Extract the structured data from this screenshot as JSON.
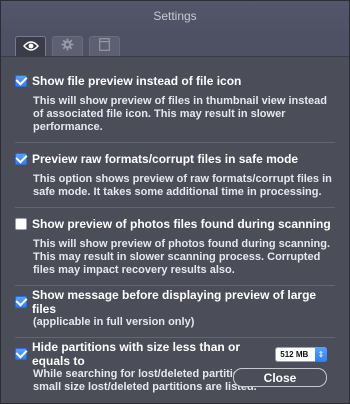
{
  "window": {
    "title": "Settings"
  },
  "toolbar": {
    "tabs": [
      {
        "icon": "eye-icon",
        "active": true
      },
      {
        "icon": "gear-icon",
        "active": false
      },
      {
        "icon": "window-icon",
        "active": false
      }
    ]
  },
  "options": [
    {
      "label": "Show file preview instead of file icon",
      "checked": true,
      "description": "This will show preview of files in thumbnail view instead of associated file icon. This may result in slower performance."
    },
    {
      "label": "Preview raw formats/corrupt files in safe mode",
      "checked": true,
      "description": "This option shows preview of raw formats/corrupt files in safe mode. It takes some additional time in processing."
    },
    {
      "label": "Show preview of photos files found during scanning",
      "checked": false,
      "description": "This will show preview of photos found during scanning. This may result in slower scanning process. Corrupted files may impact recovery results also."
    },
    {
      "label": "Show message before displaying preview of large files",
      "checked": true,
      "description": "(applicable in full version only)"
    },
    {
      "label": "Hide partitions with size less than or equals to",
      "checked": true,
      "description": "While searching for lost/deleted partitions, a number of small size lost/deleted partitions are listed.",
      "select_value": "512 MB"
    }
  ],
  "footer": {
    "close_label": "Close"
  }
}
